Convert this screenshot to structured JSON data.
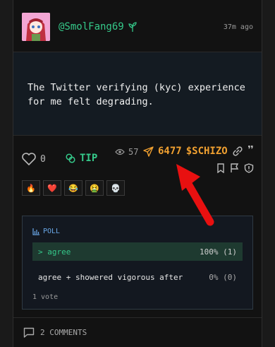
{
  "post": {
    "username": "@SmolFang69",
    "time": "37m ago",
    "text": "The Twitter verifying (kyc) experience for me felt degrading."
  },
  "actions": {
    "like_count": "0",
    "tip_label": "TIP",
    "views": "57",
    "shares": "6477",
    "token": "$SCHIZO"
  },
  "reactions": [
    "🔥",
    "❤️",
    "😂",
    "🤮",
    "💀"
  ],
  "poll": {
    "label": "POLL",
    "options": [
      {
        "label": "> agree",
        "result": "100% (1)"
      },
      {
        "label": "agree + showered vigorous after",
        "result": "0% (0)"
      }
    ],
    "votes": "1 vote"
  },
  "comments_label": "2 COMMENTS",
  "colors": {
    "accent_green": "#35c98a",
    "accent_orange": "#f0a030",
    "annotation_red": "#e81010"
  }
}
